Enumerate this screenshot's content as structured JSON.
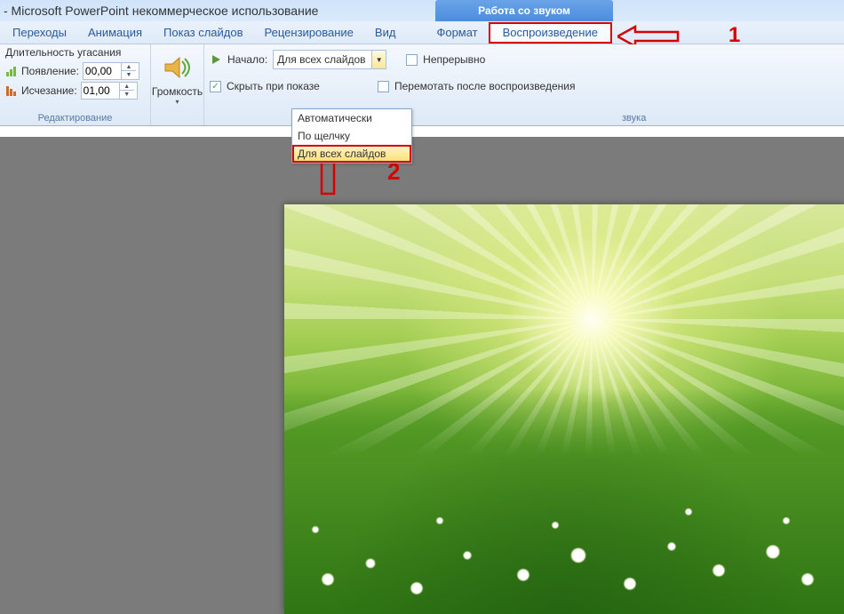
{
  "title": "-  Microsoft PowerPoint некоммерческое использование",
  "context_tab": "Работа со звуком",
  "tabs": {
    "transitions": "Переходы",
    "animation": "Анимация",
    "slideshow": "Показ слайдов",
    "review": "Рецензирование",
    "view": "Вид",
    "format": "Формат",
    "playback": "Воспроизведение"
  },
  "fade": {
    "title": "Длительность угасания",
    "appear_label": "Появление:",
    "appear_value": "00,00",
    "disappear_label": "Исчезание:",
    "disappear_value": "01,00",
    "group": "Редактирование"
  },
  "volume": {
    "label": "Громкость"
  },
  "options": {
    "start_label": "Начало:",
    "start_value": "Для всех слайдов",
    "hide_label": "Скрыть при показе",
    "hide_checked": "✓",
    "loop_label": "Непрерывно",
    "rewind_label": "Перемотать после воспроизведения",
    "group_label_suffix": "звука"
  },
  "dropdown": {
    "opt1": "Автоматически",
    "opt2": "По щелчку",
    "opt3": "Для всех слайдов"
  },
  "annotations": {
    "one": "1",
    "two": "2"
  }
}
